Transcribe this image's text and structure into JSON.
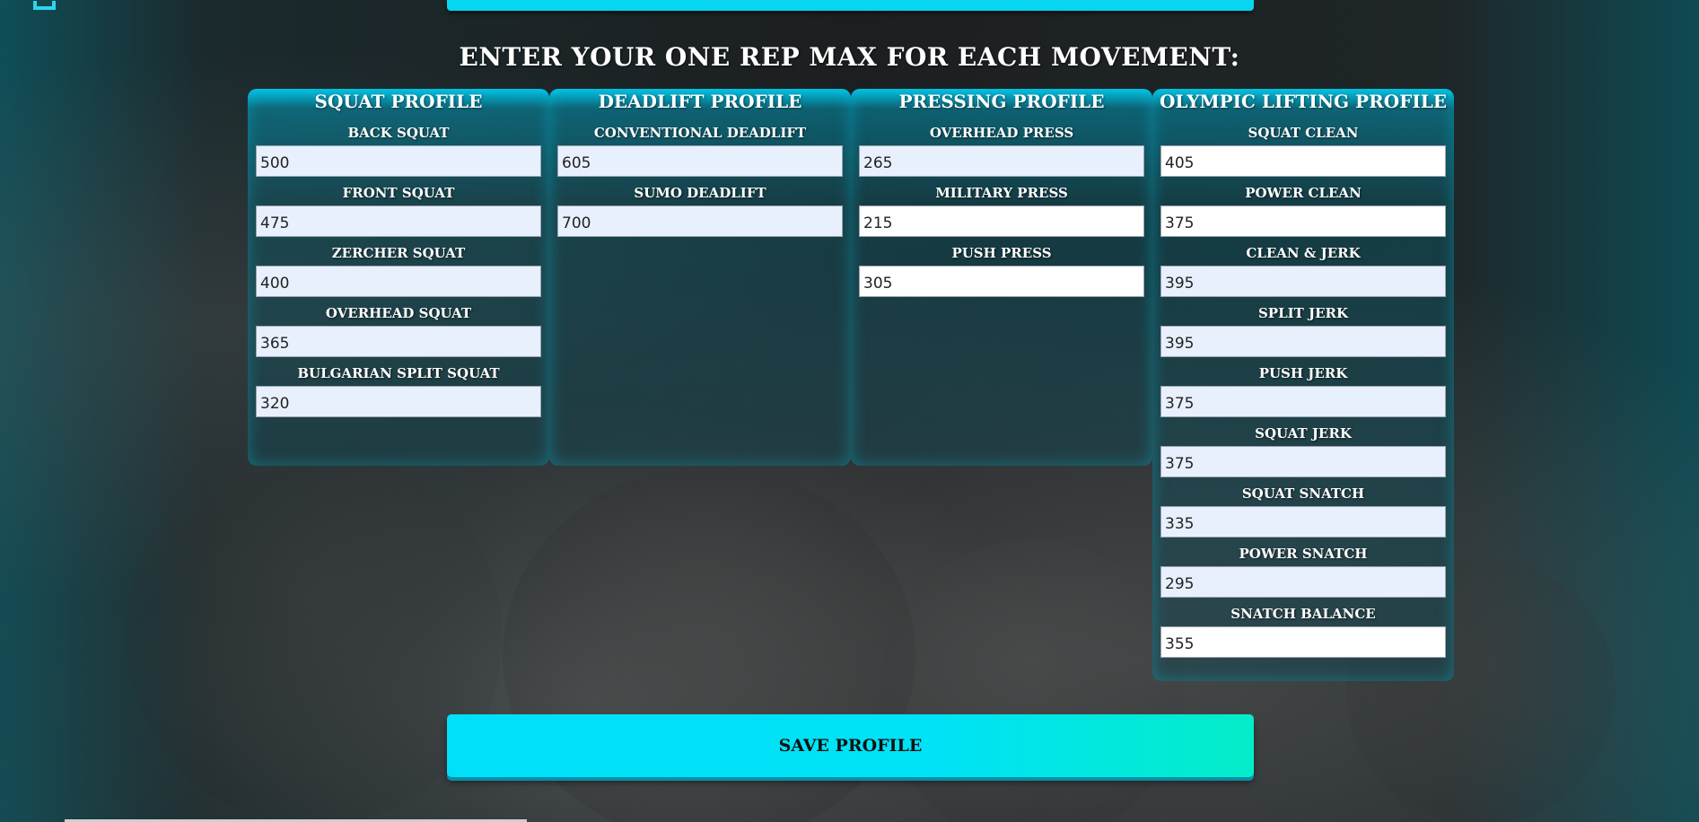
{
  "page": {
    "title": "Enter Your One Rep Max For Each Movement:"
  },
  "panels": [
    {
      "title": "Squat Profile",
      "fields": [
        {
          "label": "Back Squat",
          "value": "500"
        },
        {
          "label": "Front Squat",
          "value": "475"
        },
        {
          "label": "Zercher Squat",
          "value": "400"
        },
        {
          "label": "Overhead Squat",
          "value": "365"
        },
        {
          "label": "Bulgarian Split Squat",
          "value": "320"
        }
      ]
    },
    {
      "title": "Deadlift Profile",
      "fields": [
        {
          "label": "Conventional Deadlift",
          "value": "605"
        },
        {
          "label": "Sumo Deadlift",
          "value": "700"
        }
      ]
    },
    {
      "title": "Pressing Profile",
      "fields": [
        {
          "label": "Overhead Press",
          "value": "265"
        },
        {
          "label": "Military Press",
          "value": "215"
        },
        {
          "label": "Push Press",
          "value": "305"
        }
      ]
    },
    {
      "title": "Olympic Lifting Profile",
      "fields": [
        {
          "label": "Squat Clean",
          "value": "405"
        },
        {
          "label": "Power Clean",
          "value": "375"
        },
        {
          "label": "Clean & Jerk",
          "value": "395"
        },
        {
          "label": "Split Jerk",
          "value": "395"
        },
        {
          "label": "Push Jerk",
          "value": "375"
        },
        {
          "label": "Squat Jerk",
          "value": "375"
        },
        {
          "label": "Squat Snatch",
          "value": "335"
        },
        {
          "label": "Power Snatch",
          "value": "295"
        },
        {
          "label": "Snatch Balance",
          "value": "355"
        }
      ]
    }
  ],
  "actions": {
    "save_label": "Save Profile"
  },
  "icons": {
    "corner": "refresh-icon"
  },
  "colors": {
    "accent": "#00e0f8",
    "accent_end": "#04edc9",
    "input_autofill": "#e8f0fe",
    "input_plain": "#ffffff"
  }
}
